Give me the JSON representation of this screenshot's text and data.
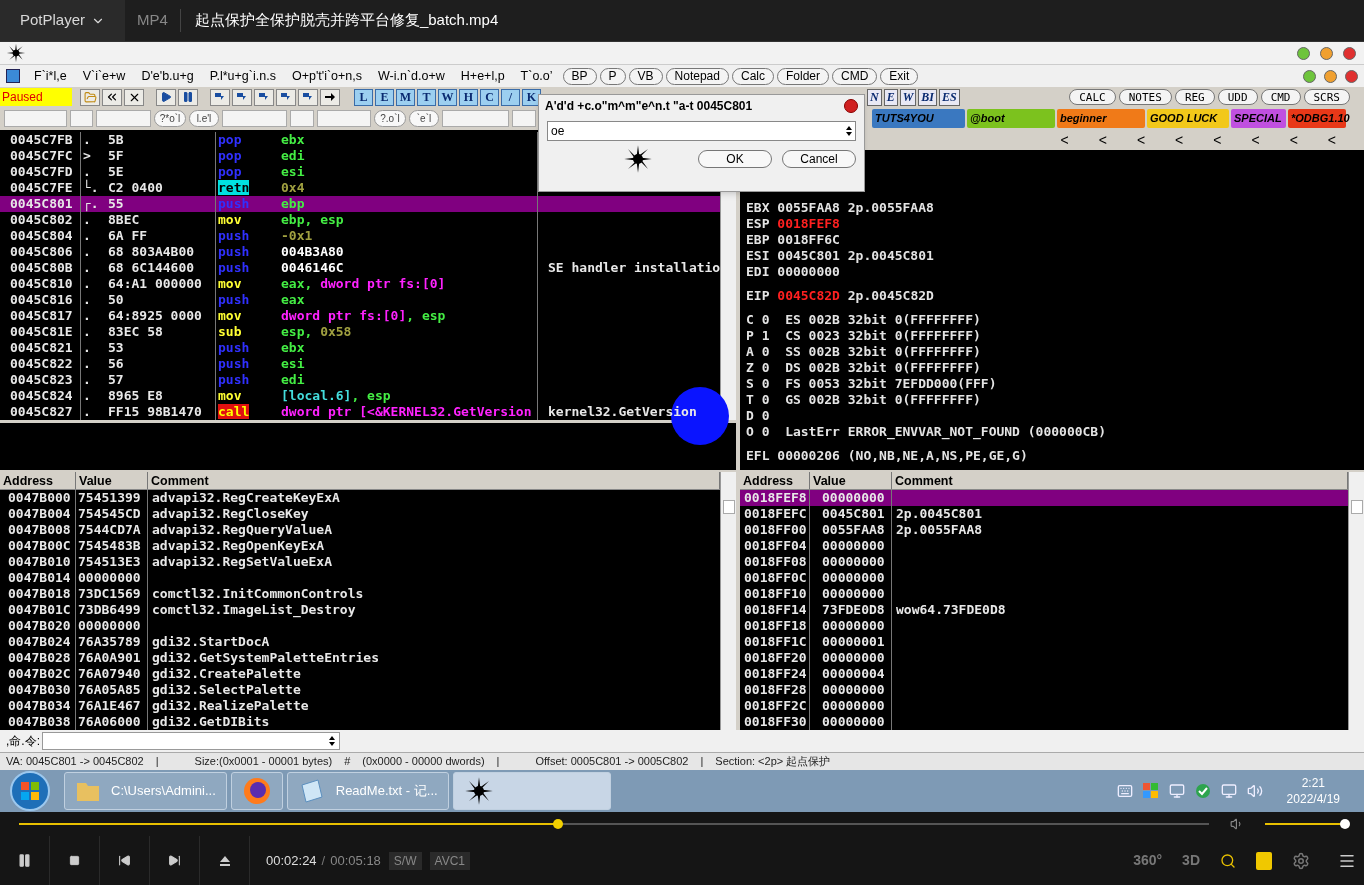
{
  "player": {
    "brand": "PotPlayer",
    "format": "MP4",
    "title": "起点保护全保护脱壳并跨平台修复_batch.mp4"
  },
  "debugger": {
    "menu": [
      "F`i*l,e",
      "V`i`e+w",
      "D'e'b.u+g",
      "P.l*u+g`i.n.s",
      "O+p't'i`o+n,s",
      "W-i.n`d.o+w",
      "H+e+l,p",
      "T`o.o’"
    ],
    "quick_buttons": [
      "BP",
      "P",
      "VB",
      "Notepad",
      "Calc",
      "Folder",
      "CMD",
      "Exit"
    ],
    "status": "Paused",
    "letters": [
      "L",
      "E",
      "M",
      "T",
      "W",
      "H",
      "C",
      "/",
      "K"
    ],
    "extra_letters": [
      "N",
      "E",
      "W",
      "BI",
      "ES"
    ],
    "right_buttons": [
      "CALC",
      "NOTES",
      "REG",
      "UDD",
      "CMD",
      "SCRS"
    ],
    "field_buttons": [
      "?*o`l",
      "l.e'l",
      "?.o`l",
      "`e`l"
    ],
    "badges": [
      {
        "text": "TUTS4YOU",
        "color": "#3a78c0"
      },
      {
        "text": "@boot",
        "color": "#7cc21e"
      },
      {
        "text": "beginner",
        "color": "#f07a18"
      },
      {
        "text": "GOOD LUCK",
        "color": "#f2c81a"
      },
      {
        "text": "SPECIAL",
        "color": "#c050e0"
      },
      {
        "text": "*ODBG1.10",
        "color": "#e83818"
      }
    ],
    "nav_arrows": [
      "<",
      "<",
      "<",
      "<",
      "<",
      "<",
      "<",
      "<"
    ],
    "disassembly": [
      {
        "address": "0045C7FB",
        "mark": ".",
        "hex": "5B",
        "mnemonic": "pop",
        "kind": "stack",
        "operand": [
          {
            "text": "ebx",
            "kind": "reg"
          }
        ],
        "selected": false
      },
      {
        "address": "0045C7FC",
        "mark": ">",
        "hex": "5F",
        "mnemonic": "pop",
        "kind": "stack",
        "operand": [
          {
            "text": "edi",
            "kind": "reg"
          }
        ],
        "selected": false
      },
      {
        "address": "0045C7FD",
        "mark": ".",
        "hex": "5E",
        "mnemonic": "pop",
        "kind": "stack",
        "operand": [
          {
            "text": "esi",
            "kind": "reg"
          }
        ],
        "selected": false
      },
      {
        "address": "0045C7FE",
        "mark": "└.",
        "hex": "C2 0400",
        "mnemonic": "retn",
        "kind": "return",
        "operand": [
          {
            "text": "0x4",
            "kind": "const"
          }
        ],
        "selected": false
      },
      {
        "address": "0045C801",
        "mark": "┌.",
        "hex": "55",
        "mnemonic": "push",
        "kind": "stack",
        "operand": [
          {
            "text": "ebp",
            "kind": "reg"
          }
        ],
        "selected": true
      },
      {
        "address": "0045C802",
        "mark": ".",
        "hex": "8BEC",
        "mnemonic": "mov",
        "kind": "move",
        "operand": [
          {
            "text": "ebp, esp",
            "kind": "reg"
          }
        ],
        "selected": false
      },
      {
        "address": "0045C804",
        "mark": ".",
        "hex": "6A FF",
        "mnemonic": "push",
        "kind": "stack",
        "operand": [
          {
            "text": "-0x1",
            "kind": "const"
          }
        ],
        "selected": false
      },
      {
        "address": "0045C806",
        "mark": ".",
        "hex": "68 803A4B00",
        "mnemonic": "push",
        "kind": "stack",
        "operand": [
          {
            "text": "004B3A80",
            "kind": "imm"
          }
        ],
        "selected": false
      },
      {
        "address": "0045C80B",
        "mark": ".",
        "hex": "68 6C144600",
        "mnemonic": "push",
        "kind": "stack",
        "operand": [
          {
            "text": "0046146C",
            "kind": "imm"
          }
        ],
        "comment": "SE handler installatio",
        "selected": false
      },
      {
        "address": "0045C810",
        "mark": ".",
        "hex": "64:A1 000000",
        "mnemonic": "mov",
        "kind": "move",
        "operand": [
          {
            "text": "eax, ",
            "kind": "reg"
          },
          {
            "text": "dword ptr fs:[0]",
            "kind": "mem"
          }
        ],
        "selected": false
      },
      {
        "address": "0045C816",
        "mark": ".",
        "hex": "50",
        "mnemonic": "push",
        "kind": "stack",
        "operand": [
          {
            "text": "eax",
            "kind": "reg"
          }
        ],
        "selected": false
      },
      {
        "address": "0045C817",
        "mark": ".",
        "hex": "64:8925 0000",
        "mnemonic": "mov",
        "kind": "move",
        "operand": [
          {
            "text": "dword ptr fs:[0]",
            "kind": "mem"
          },
          {
            "text": ", esp",
            "kind": "reg"
          }
        ],
        "selected": false
      },
      {
        "address": "0045C81E",
        "mark": ".",
        "hex": "83EC 58",
        "mnemonic": "sub",
        "kind": "move",
        "operand": [
          {
            "text": "esp, ",
            "kind": "reg"
          },
          {
            "text": "0x58",
            "kind": "const"
          }
        ],
        "selected": false
      },
      {
        "address": "0045C821",
        "mark": ".",
        "hex": "53",
        "mnemonic": "push",
        "kind": "stack",
        "operand": [
          {
            "text": "ebx",
            "kind": "reg"
          }
        ],
        "selected": false
      },
      {
        "address": "0045C822",
        "mark": ".",
        "hex": "56",
        "mnemonic": "push",
        "kind": "stack",
        "operand": [
          {
            "text": "esi",
            "kind": "reg"
          }
        ],
        "selected": false
      },
      {
        "address": "0045C823",
        "mark": ".",
        "hex": "57",
        "mnemonic": "push",
        "kind": "stack",
        "operand": [
          {
            "text": "edi",
            "kind": "reg"
          }
        ],
        "selected": false
      },
      {
        "address": "0045C824",
        "mark": ".",
        "hex": "8965 E8",
        "mnemonic": "mov",
        "kind": "move",
        "operand": [
          {
            "text": "[local.6]",
            "kind": "local"
          },
          {
            "text": ", esp",
            "kind": "reg"
          }
        ],
        "selected": false
      },
      {
        "address": "0045C827",
        "mark": ".",
        "hex": "FF15 98B1470",
        "mnemonic": "call",
        "kind": "call",
        "operand": [
          {
            "text": "dword ptr [<&KERNEL32.GetVersion",
            "kind": "mem"
          }
        ],
        "comment": "kernel32.GetVersion",
        "selected": false
      }
    ],
    "register_groups": [
      [
        [
          {
            "text": "EBX 0055FAA8 2p.0055FAA8",
            "changed": false
          }
        ],
        [
          {
            "text": "ESP ",
            "changed": false
          },
          {
            "text": "0018FEF8",
            "changed": true
          }
        ],
        [
          {
            "text": "EBP 0018FF6C",
            "changed": false
          }
        ],
        [
          {
            "text": "ESI 0045C801 2p.0045C801",
            "changed": false
          }
        ],
        [
          {
            "text": "EDI 00000000",
            "changed": false
          }
        ]
      ],
      [
        [
          {
            "text": "EIP ",
            "changed": false
          },
          {
            "text": "0045C82D",
            "changed": true
          },
          {
            "text": " 2p.0045C82D",
            "changed": false
          }
        ]
      ],
      [
        [
          {
            "text": "C 0  ES 002B 32bit 0(FFFFFFFF)",
            "changed": false
          }
        ],
        [
          {
            "text": "P 1  CS 0023 32bit 0(FFFFFFFF)",
            "changed": false
          }
        ],
        [
          {
            "text": "A 0  SS 002B 32bit 0(FFFFFFFF)",
            "changed": false
          }
        ],
        [
          {
            "text": "Z 0  DS 002B 32bit 0(FFFFFFFF)",
            "changed": false
          }
        ],
        [
          {
            "text": "S 0  FS 0053 32bit 7EFDD000(FFF)",
            "changed": false
          }
        ],
        [
          {
            "text": "T 0  GS 002B 32bit 0(FFFFFFFF)",
            "changed": false
          }
        ],
        [
          {
            "text": "D 0",
            "changed": false
          }
        ],
        [
          {
            "text": "O 0  LastErr ERROR_ENVVAR_NOT_FOUND (000000CB)",
            "changed": false
          }
        ]
      ],
      [
        [
          {
            "text": "EFL 00000206 (NO,NB,NE,A,NS,PE,GE,G)",
            "changed": false
          }
        ]
      ]
    ],
    "dump": {
      "columns": [
        "Address",
        "Value",
        "Comment"
      ],
      "rows": [
        {
          "address": "0047B000",
          "value": "75451399",
          "comment": "advapi32.RegCreateKeyExA"
        },
        {
          "address": "0047B004",
          "value": "754545CD",
          "comment": "advapi32.RegCloseKey"
        },
        {
          "address": "0047B008",
          "value": "7544CD7A",
          "comment": "advapi32.RegQueryValueA"
        },
        {
          "address": "0047B00C",
          "value": "7545483B",
          "comment": "advapi32.RegOpenKeyExA"
        },
        {
          "address": "0047B010",
          "value": "754513E3",
          "comment": "advapi32.RegSetValueExA"
        },
        {
          "address": "0047B014",
          "value": "00000000"
        },
        {
          "address": "0047B018",
          "value": "73DC1569",
          "comment": "comctl32.InitCommonControls"
        },
        {
          "address": "0047B01C",
          "value": "73DB6499",
          "comment": "comctl32.ImageList_Destroy"
        },
        {
          "address": "0047B020",
          "value": "00000000"
        },
        {
          "address": "0047B024",
          "value": "76A35789",
          "comment": "gdi32.StartDocA"
        },
        {
          "address": "0047B028",
          "value": "76A0A901",
          "comment": "gdi32.GetSystemPaletteEntries"
        },
        {
          "address": "0047B02C",
          "value": "76A07940",
          "comment": "gdi32.CreatePalette"
        },
        {
          "address": "0047B030",
          "value": "76A05A85",
          "comment": "gdi32.SelectPalette"
        },
        {
          "address": "0047B034",
          "value": "76A1E467",
          "comment": "gdi32.RealizePalette"
        },
        {
          "address": "0047B038",
          "value": "76A06000",
          "comment": "gdi32.GetDIBits"
        }
      ]
    },
    "stack": {
      "columns": [
        "Address",
        "Value",
        "Comment"
      ],
      "rows": [
        {
          "address": "0018FEF8",
          "value": "00000000",
          "selected": true
        },
        {
          "address": "0018FEFC",
          "value": "0045C801",
          "comment": "2p.0045C801",
          "selected": false
        },
        {
          "address": "0018FF00",
          "value": "0055FAA8",
          "comment": "2p.0055FAA8",
          "selected": false
        },
        {
          "address": "0018FF04",
          "value": "00000000",
          "selected": false
        },
        {
          "address": "0018FF08",
          "value": "00000000",
          "selected": false
        },
        {
          "address": "0018FF0C",
          "value": "00000000",
          "selected": false
        },
        {
          "address": "0018FF10",
          "value": "00000000",
          "selected": false
        },
        {
          "address": "0018FF14",
          "value": "73FDE0D8",
          "comment": "wow64.73FDE0D8",
          "selected": false
        },
        {
          "address": "0018FF18",
          "value": "00000000",
          "selected": false
        },
        {
          "address": "0018FF1C",
          "value": "00000001",
          "selected": false
        },
        {
          "address": "0018FF20",
          "value": "00000000",
          "selected": false
        },
        {
          "address": "0018FF24",
          "value": "00000004",
          "selected": false
        },
        {
          "address": "0018FF28",
          "value": "00000000",
          "selected": false
        },
        {
          "address": "0018FF2C",
          "value": "00000000",
          "selected": false
        },
        {
          "address": "0018FF30",
          "value": "00000000",
          "selected": false
        }
      ]
    },
    "command_label": ",命.令:",
    "status_bar": [
      "VA: 0045C801 -> 0045C802",
      "|",
      "Size:(0x0001 - 00001 bytes)",
      "#",
      "(0x0000 - 00000 dwords)",
      "|",
      "Offset: 0005C801 -> 0005C802",
      "|",
      "Section: <2p> 起点保护"
    ],
    "dialog": {
      "title": "A'd'd +c.o\"m^m\"e^n.t \"a-t 0045C801",
      "value": "oe",
      "buttons": [
        "OK",
        "Cancel"
      ]
    }
  },
  "taskbar": {
    "items": [
      {
        "kind": "folder",
        "label": "C:\\Users\\Admini...",
        "selected": false
      },
      {
        "kind": "browser",
        "selected": false
      },
      {
        "kind": "notepad",
        "label": "ReadMe.txt - 记...",
        "selected": false
      },
      {
        "kind": "debugger",
        "selected": true
      }
    ],
    "time": "2:21",
    "date": "2022/4/19"
  },
  "controls": {
    "seek": {
      "level": 0.453
    },
    "volume": {
      "level": 1
    },
    "elapsed": "00:02:24",
    "separator": "/",
    "duration": "00:05:18",
    "decoder": "S/W",
    "codec": "AVC1",
    "view_buttons": [
      "360°",
      "3D"
    ]
  }
}
